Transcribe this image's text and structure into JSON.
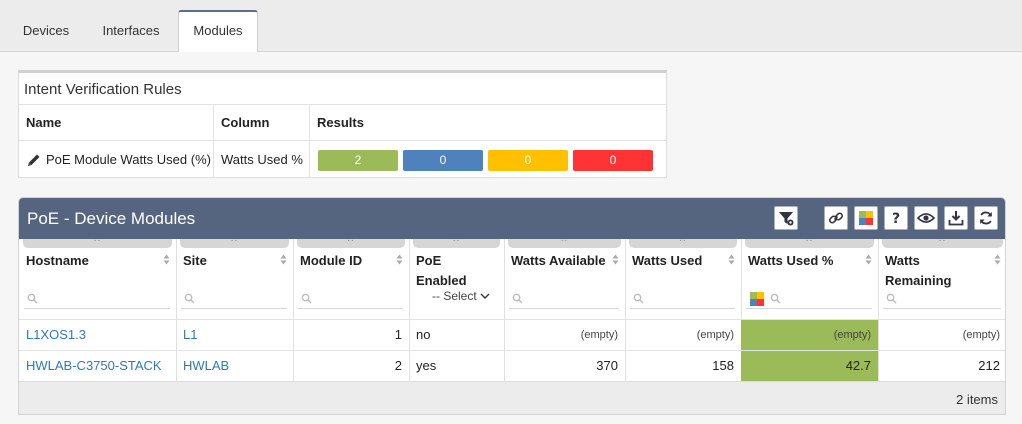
{
  "tabs": [
    "Devices",
    "Interfaces",
    "Modules"
  ],
  "active_tab": "Modules",
  "intent_rules": {
    "title": "Intent Verification Rules",
    "headers": {
      "name": "Name",
      "column": "Column",
      "results": "Results"
    },
    "rule": {
      "name": "PoE Module Watts Used (%)",
      "column": "Watts Used %",
      "icon": "pencil-icon",
      "results": [
        {
          "value": "2",
          "color": "#9bbb59"
        },
        {
          "value": "0",
          "color": "#4f81bd"
        },
        {
          "value": "0",
          "color": "#ffc000"
        },
        {
          "value": "0",
          "color": "#ff3333"
        }
      ]
    }
  },
  "panel": {
    "title": "PoE - Device Modules",
    "toolbar_icons": [
      "filter-settings-icon",
      "link-icon",
      "color-grid-icon",
      "help-icon",
      "eye-icon",
      "download-icon",
      "refresh-icon"
    ],
    "columns": {
      "hostname": "Hostname",
      "site": "Site",
      "module_id": "Module ID",
      "poe_enabled_1": "PoE",
      "poe_enabled_2": "Enabled",
      "watts_available": "Watts Available",
      "watts_used": "Watts Used",
      "watts_used_pct": "Watts Used %",
      "watts_remaining_1": "Watts",
      "watts_remaining_2": "Remaining"
    },
    "poe_filter_placeholder": "-- Select",
    "rows": [
      {
        "hostname": "L1XOS1.3",
        "site": "L1",
        "module_id": "1",
        "poe_enabled": "no",
        "watts_available": "(empty)",
        "watts_used": "(empty)",
        "watts_used_pct": "(empty)",
        "watts_remaining": "(empty)"
      },
      {
        "hostname": "HWLAB-C3750-STACK",
        "site": "HWLAB",
        "module_id": "2",
        "poe_enabled": "yes",
        "watts_available": "370",
        "watts_used": "158",
        "watts_used_pct": "42.7",
        "watts_remaining": "212"
      }
    ],
    "highlight_color": "#9bbb59",
    "item_count": "2 items"
  }
}
